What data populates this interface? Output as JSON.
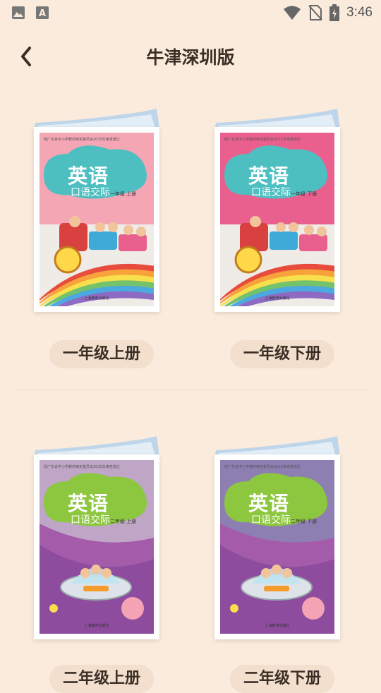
{
  "status": {
    "time": "3:46"
  },
  "header": {
    "title": "牛津深圳版"
  },
  "books": [
    {
      "label": "一年级上册",
      "cover_title": "英语",
      "cover_sub": "口语交际",
      "cover_grade": "一年级  上册",
      "cover_note": "经广东省中小学教材审定委员会2015年审查通过",
      "publisher": "上海教育出版社",
      "bg_top": "#F5A6B5",
      "cloud": "#4DBFC0"
    },
    {
      "label": "一年级下册",
      "cover_title": "英语",
      "cover_sub": "口语交际",
      "cover_grade": "一年级  下册",
      "cover_note": "经广东省中小学教材审定委员会2015年审查通过",
      "publisher": "上海教育出版社",
      "bg_top": "#E9608F",
      "cloud": "#4DBFC0"
    },
    {
      "label": "二年级上册",
      "cover_title": "英语",
      "cover_sub": "口语交际",
      "cover_grade": "二年级  上册",
      "cover_note": "经广东省中小学教材审定委员会2015年审查通过",
      "publisher": "上海教育出版社",
      "bg_top": "#BFA6C7",
      "cloud": "#8DC63F"
    },
    {
      "label": "二年级下册",
      "cover_title": "英语",
      "cover_sub": "口语交际",
      "cover_grade": "二年级  下册",
      "cover_note": "经广东省中小学教材审定委员会2015年审查通过",
      "publisher": "上海教育出版社",
      "bg_top": "#8E7FB3",
      "cloud": "#8DC63F"
    }
  ]
}
